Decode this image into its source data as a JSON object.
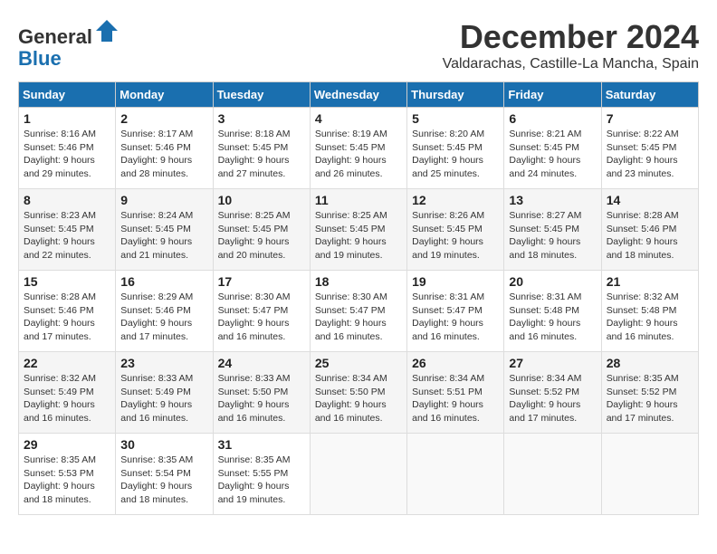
{
  "header": {
    "logo_general": "General",
    "logo_blue": "Blue",
    "month_title": "December 2024",
    "location": "Valdarachas, Castille-La Mancha, Spain"
  },
  "weekdays": [
    "Sunday",
    "Monday",
    "Tuesday",
    "Wednesday",
    "Thursday",
    "Friday",
    "Saturday"
  ],
  "weeks": [
    [
      {
        "day": "1",
        "sunrise": "Sunrise: 8:16 AM",
        "sunset": "Sunset: 5:46 PM",
        "daylight": "Daylight: 9 hours and 29 minutes."
      },
      {
        "day": "2",
        "sunrise": "Sunrise: 8:17 AM",
        "sunset": "Sunset: 5:46 PM",
        "daylight": "Daylight: 9 hours and 28 minutes."
      },
      {
        "day": "3",
        "sunrise": "Sunrise: 8:18 AM",
        "sunset": "Sunset: 5:45 PM",
        "daylight": "Daylight: 9 hours and 27 minutes."
      },
      {
        "day": "4",
        "sunrise": "Sunrise: 8:19 AM",
        "sunset": "Sunset: 5:45 PM",
        "daylight": "Daylight: 9 hours and 26 minutes."
      },
      {
        "day": "5",
        "sunrise": "Sunrise: 8:20 AM",
        "sunset": "Sunset: 5:45 PM",
        "daylight": "Daylight: 9 hours and 25 minutes."
      },
      {
        "day": "6",
        "sunrise": "Sunrise: 8:21 AM",
        "sunset": "Sunset: 5:45 PM",
        "daylight": "Daylight: 9 hours and 24 minutes."
      },
      {
        "day": "7",
        "sunrise": "Sunrise: 8:22 AM",
        "sunset": "Sunset: 5:45 PM",
        "daylight": "Daylight: 9 hours and 23 minutes."
      }
    ],
    [
      {
        "day": "8",
        "sunrise": "Sunrise: 8:23 AM",
        "sunset": "Sunset: 5:45 PM",
        "daylight": "Daylight: 9 hours and 22 minutes."
      },
      {
        "day": "9",
        "sunrise": "Sunrise: 8:24 AM",
        "sunset": "Sunset: 5:45 PM",
        "daylight": "Daylight: 9 hours and 21 minutes."
      },
      {
        "day": "10",
        "sunrise": "Sunrise: 8:25 AM",
        "sunset": "Sunset: 5:45 PM",
        "daylight": "Daylight: 9 hours and 20 minutes."
      },
      {
        "day": "11",
        "sunrise": "Sunrise: 8:25 AM",
        "sunset": "Sunset: 5:45 PM",
        "daylight": "Daylight: 9 hours and 19 minutes."
      },
      {
        "day": "12",
        "sunrise": "Sunrise: 8:26 AM",
        "sunset": "Sunset: 5:45 PM",
        "daylight": "Daylight: 9 hours and 19 minutes."
      },
      {
        "day": "13",
        "sunrise": "Sunrise: 8:27 AM",
        "sunset": "Sunset: 5:45 PM",
        "daylight": "Daylight: 9 hours and 18 minutes."
      },
      {
        "day": "14",
        "sunrise": "Sunrise: 8:28 AM",
        "sunset": "Sunset: 5:46 PM",
        "daylight": "Daylight: 9 hours and 18 minutes."
      }
    ],
    [
      {
        "day": "15",
        "sunrise": "Sunrise: 8:28 AM",
        "sunset": "Sunset: 5:46 PM",
        "daylight": "Daylight: 9 hours and 17 minutes."
      },
      {
        "day": "16",
        "sunrise": "Sunrise: 8:29 AM",
        "sunset": "Sunset: 5:46 PM",
        "daylight": "Daylight: 9 hours and 17 minutes."
      },
      {
        "day": "17",
        "sunrise": "Sunrise: 8:30 AM",
        "sunset": "Sunset: 5:47 PM",
        "daylight": "Daylight: 9 hours and 16 minutes."
      },
      {
        "day": "18",
        "sunrise": "Sunrise: 8:30 AM",
        "sunset": "Sunset: 5:47 PM",
        "daylight": "Daylight: 9 hours and 16 minutes."
      },
      {
        "day": "19",
        "sunrise": "Sunrise: 8:31 AM",
        "sunset": "Sunset: 5:47 PM",
        "daylight": "Daylight: 9 hours and 16 minutes."
      },
      {
        "day": "20",
        "sunrise": "Sunrise: 8:31 AM",
        "sunset": "Sunset: 5:48 PM",
        "daylight": "Daylight: 9 hours and 16 minutes."
      },
      {
        "day": "21",
        "sunrise": "Sunrise: 8:32 AM",
        "sunset": "Sunset: 5:48 PM",
        "daylight": "Daylight: 9 hours and 16 minutes."
      }
    ],
    [
      {
        "day": "22",
        "sunrise": "Sunrise: 8:32 AM",
        "sunset": "Sunset: 5:49 PM",
        "daylight": "Daylight: 9 hours and 16 minutes."
      },
      {
        "day": "23",
        "sunrise": "Sunrise: 8:33 AM",
        "sunset": "Sunset: 5:49 PM",
        "daylight": "Daylight: 9 hours and 16 minutes."
      },
      {
        "day": "24",
        "sunrise": "Sunrise: 8:33 AM",
        "sunset": "Sunset: 5:50 PM",
        "daylight": "Daylight: 9 hours and 16 minutes."
      },
      {
        "day": "25",
        "sunrise": "Sunrise: 8:34 AM",
        "sunset": "Sunset: 5:50 PM",
        "daylight": "Daylight: 9 hours and 16 minutes."
      },
      {
        "day": "26",
        "sunrise": "Sunrise: 8:34 AM",
        "sunset": "Sunset: 5:51 PM",
        "daylight": "Daylight: 9 hours and 16 minutes."
      },
      {
        "day": "27",
        "sunrise": "Sunrise: 8:34 AM",
        "sunset": "Sunset: 5:52 PM",
        "daylight": "Daylight: 9 hours and 17 minutes."
      },
      {
        "day": "28",
        "sunrise": "Sunrise: 8:35 AM",
        "sunset": "Sunset: 5:52 PM",
        "daylight": "Daylight: 9 hours and 17 minutes."
      }
    ],
    [
      {
        "day": "29",
        "sunrise": "Sunrise: 8:35 AM",
        "sunset": "Sunset: 5:53 PM",
        "daylight": "Daylight: 9 hours and 18 minutes."
      },
      {
        "day": "30",
        "sunrise": "Sunrise: 8:35 AM",
        "sunset": "Sunset: 5:54 PM",
        "daylight": "Daylight: 9 hours and 18 minutes."
      },
      {
        "day": "31",
        "sunrise": "Sunrise: 8:35 AM",
        "sunset": "Sunset: 5:55 PM",
        "daylight": "Daylight: 9 hours and 19 minutes."
      },
      null,
      null,
      null,
      null
    ]
  ]
}
